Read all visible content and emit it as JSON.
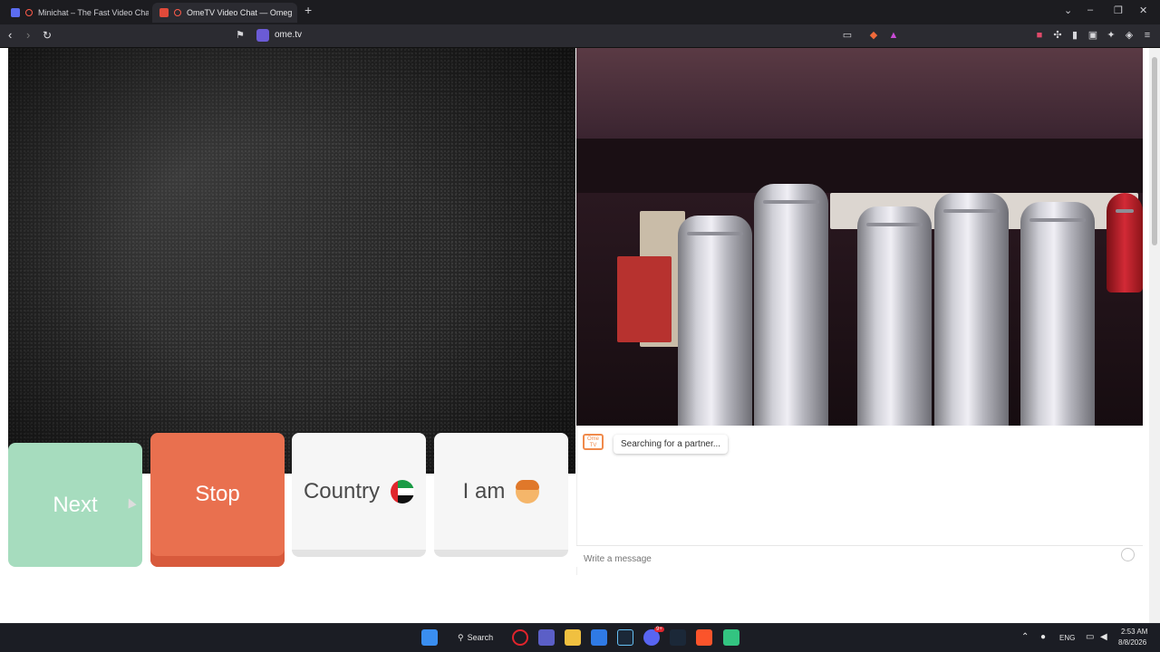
{
  "browser": {
    "tabs": [
      {
        "title": "Minichat – The Fast Video Chat",
        "active": false
      },
      {
        "title": "OmeTV Video Chat — Omeg",
        "active": true
      }
    ],
    "new_tab_icon": "plus-icon",
    "address": "ome.tv",
    "window_controls": [
      "chevron-down-icon",
      "minimize-icon",
      "restore-icon",
      "close-icon"
    ]
  },
  "controls": {
    "next_label": "Next",
    "stop_label": "Stop",
    "country_label": "Country",
    "country_flag": "ae-flag-icon",
    "iam_label": "I am",
    "iam_icon": "boy-emoji-icon"
  },
  "chat": {
    "logo_text": "Ome TV",
    "status": "Searching for a partner...",
    "input_placeholder": "Write a message"
  },
  "taskbar": {
    "search_label": "Search",
    "discord_badge": "9+",
    "language": "ENG",
    "time": "2:53 AM",
    "date": "8/8/2026"
  },
  "colors": {
    "next": "#a6dcbe",
    "stop": "#e9704f",
    "neutral_button": "#f6f6f6",
    "accent_orange": "#f08a4b"
  }
}
